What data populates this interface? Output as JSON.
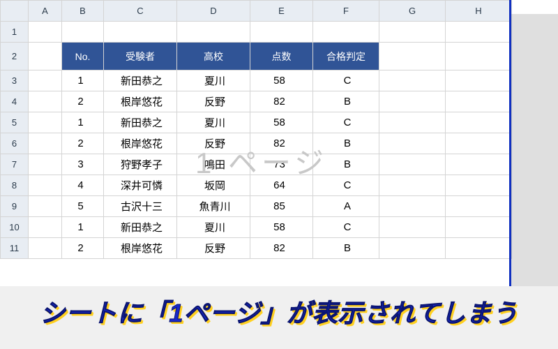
{
  "columns": [
    "A",
    "B",
    "C",
    "D",
    "E",
    "F",
    "G",
    "H"
  ],
  "row_numbers": [
    1,
    2,
    3,
    4,
    5,
    6,
    7,
    8,
    9,
    10,
    11
  ],
  "headers": {
    "no": "No.",
    "examinee": "受験者",
    "school": "高校",
    "score": "点数",
    "result": "合格判定"
  },
  "rows": [
    {
      "no": 1,
      "examinee": "新田恭之",
      "school": "夏川",
      "score": 58,
      "result": "C"
    },
    {
      "no": 2,
      "examinee": "根岸悠花",
      "school": "反野",
      "score": 82,
      "result": "B"
    },
    {
      "no": 1,
      "examinee": "新田恭之",
      "school": "夏川",
      "score": 58,
      "result": "C"
    },
    {
      "no": 2,
      "examinee": "根岸悠花",
      "school": "反野",
      "score": 82,
      "result": "B"
    },
    {
      "no": 3,
      "examinee": "狩野孝子",
      "school": "鳴田",
      "score": 73,
      "result": "B"
    },
    {
      "no": 4,
      "examinee": "深井可憐",
      "school": "坂岡",
      "score": 64,
      "result": "C"
    },
    {
      "no": 5,
      "examinee": "古沢十三",
      "school": "魚青川",
      "score": 85,
      "result": "A"
    },
    {
      "no": 1,
      "examinee": "新田恭之",
      "school": "夏川",
      "score": 58,
      "result": "C"
    },
    {
      "no": 2,
      "examinee": "根岸悠花",
      "school": "反野",
      "score": 82,
      "result": "B"
    }
  ],
  "watermark": "1 ページ",
  "caption": "シートに「1ページ」が表示されてしまう"
}
